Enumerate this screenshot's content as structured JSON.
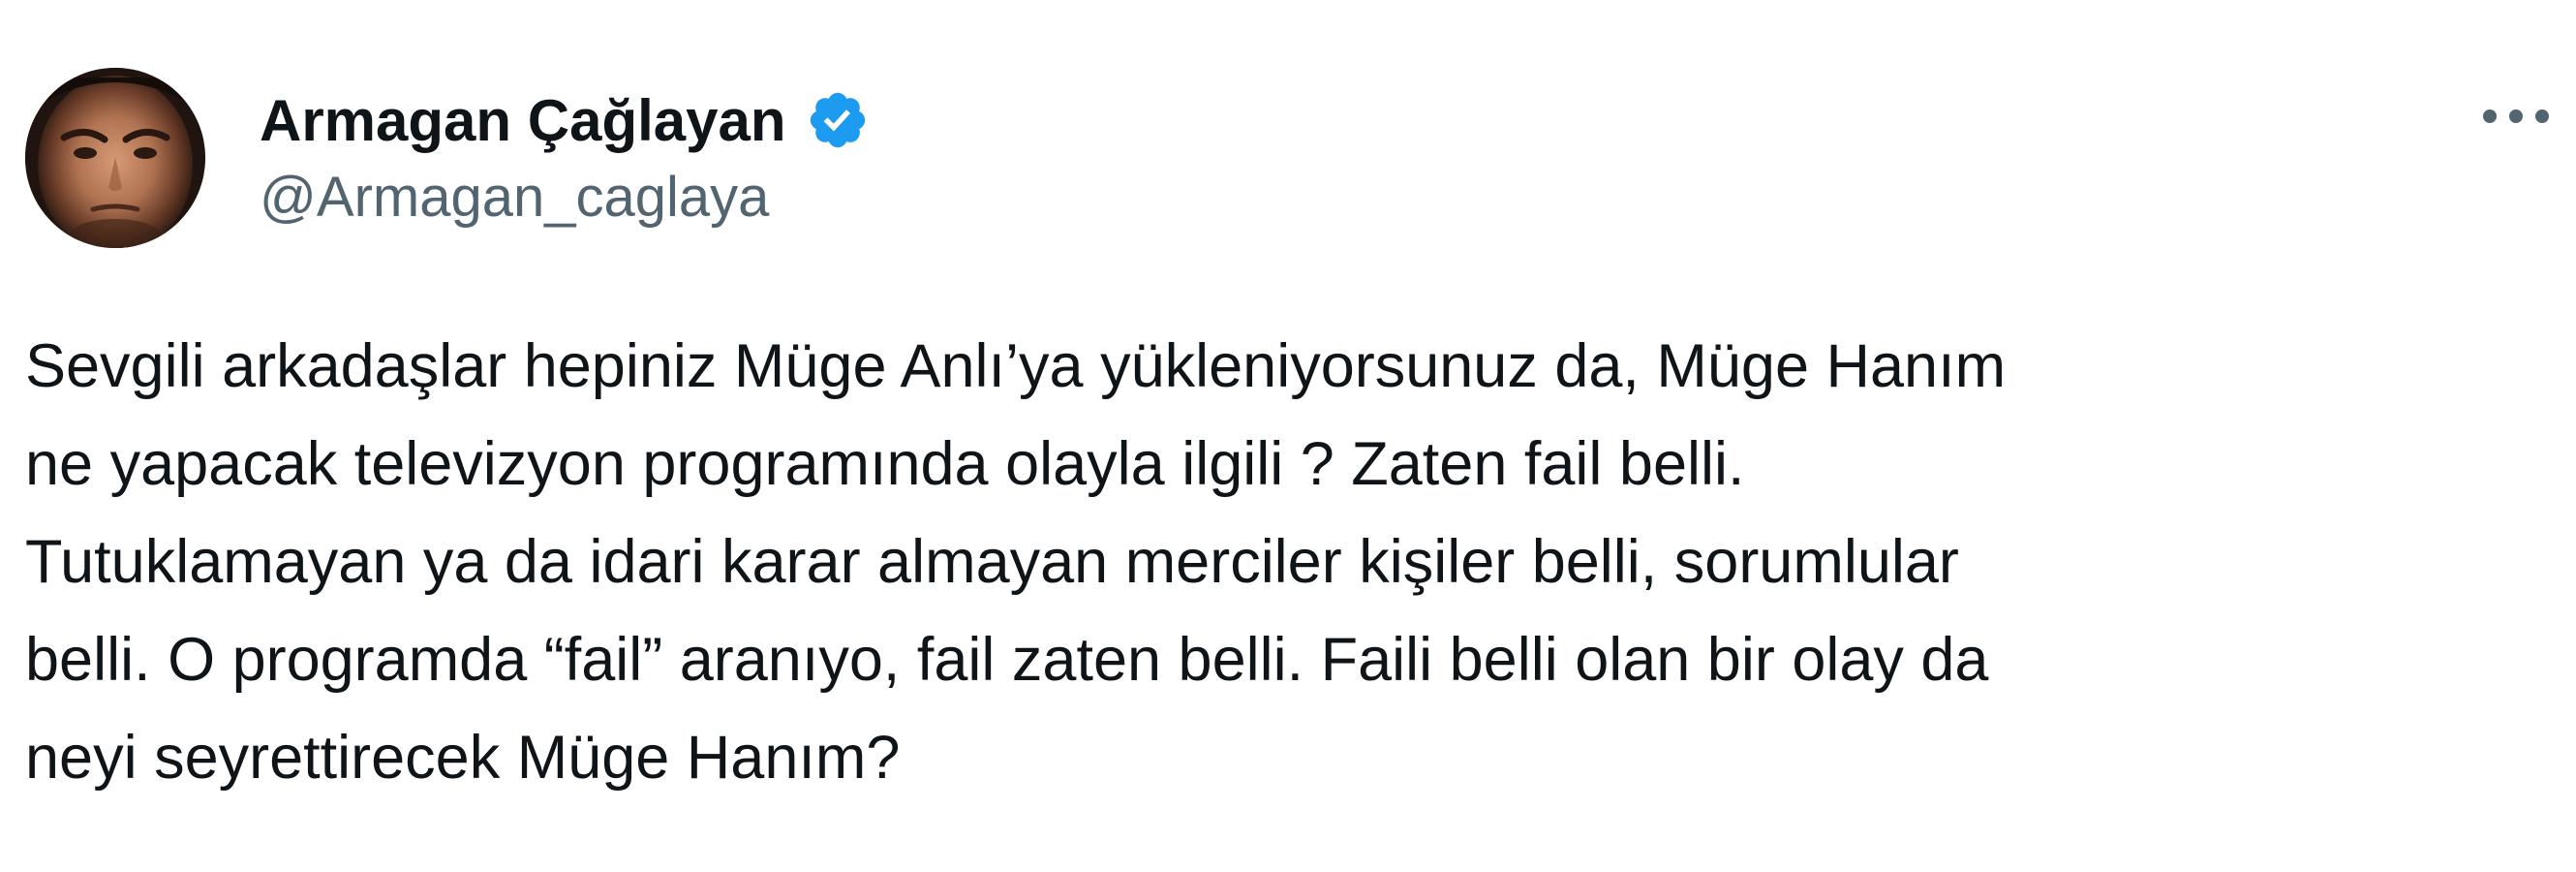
{
  "author": {
    "display_name": "Armagan Çağlayan",
    "handle": "@Armagan_caglaya",
    "verified": true,
    "verified_icon": "verified-badge-icon",
    "avatar": "profile-photo"
  },
  "menu": {
    "more_icon": "more-horizontal-icon"
  },
  "tweet": {
    "lines": [
      "Sevgili arkadaşlar hepiniz Müge Anlı’ya yükleniyorsunuz da, Müge Hanım",
      "ne yapacak televizyon programında olayla ilgili ? Zaten fail belli.",
      "Tutuklamayan ya da idari karar almayan merciler kişiler belli, sorumlular",
      "belli. O programda “fail” aranıyo, fail zaten belli. Faili belli olan bir olay da",
      "neyi seyrettirecek Müge Hanım?"
    ]
  },
  "colors": {
    "text": "#0f1419",
    "secondary": "#536471",
    "verified": "#1d9bf0",
    "background": "#ffffff"
  }
}
